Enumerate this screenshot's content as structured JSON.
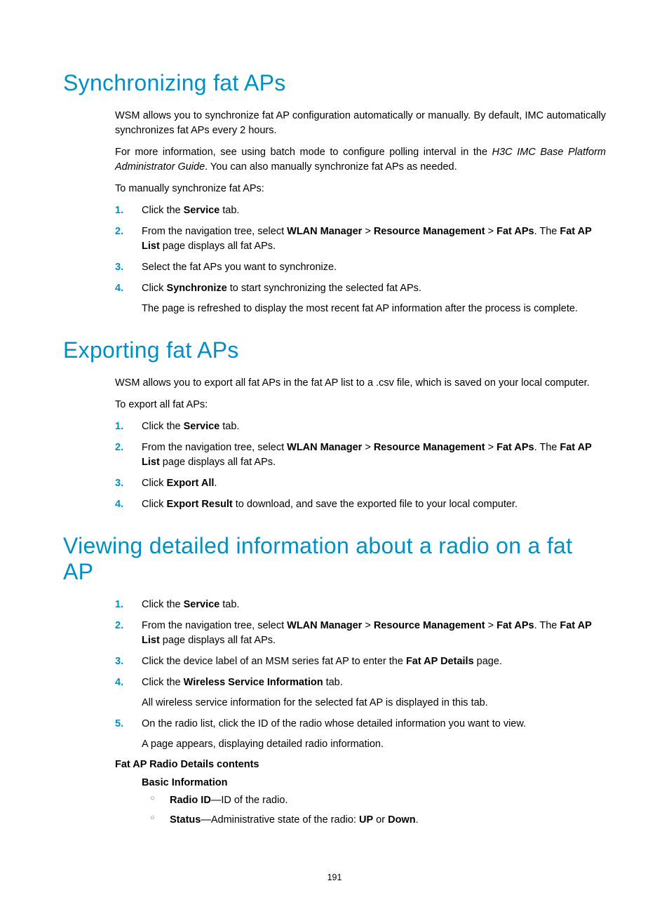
{
  "pageNumber": "191",
  "sections": [
    {
      "id": "sync",
      "heading": "Synchronizing fat APs",
      "intro1_pre": "WSM allows you to synchronize fat AP configuration automatically or manually. By default, IMC automatically synchronizes fat APs every 2 hours.",
      "intro2_pre": "For more information, see using batch mode to configure polling interval in the ",
      "intro2_italic": "H3C IMC Base Platform Administrator Guide",
      "intro2_post": ". You can also manually synchronize fat APs as needed.",
      "lead": "To manually synchronize fat APs:",
      "steps": [
        {
          "pre": "Click the ",
          "b1": "Service",
          "post": " tab."
        },
        {
          "pre": "From the navigation tree, select ",
          "b1": "WLAN Manager",
          "mid1": " > ",
          "b2": "Resource Management",
          "mid2": " > ",
          "b3": "Fat APs",
          "mid3": ". The ",
          "b4": "Fat AP List",
          "post": " page displays all fat APs."
        },
        {
          "pre": "Select the fat APs you want to synchronize."
        },
        {
          "pre": "Click ",
          "b1": "Synchronize",
          "post": " to start synchronizing the selected fat APs.",
          "sub": "The page is refreshed to display the most recent fat AP information after the process is complete."
        }
      ]
    },
    {
      "id": "export",
      "heading": "Exporting fat APs",
      "intro1_pre": "WSM allows you to export all fat APs in the fat AP list to a .csv file, which is saved on your local computer.",
      "lead": "To export all fat APs:",
      "steps": [
        {
          "pre": "Click the ",
          "b1": "Service",
          "post": " tab."
        },
        {
          "pre": "From the navigation tree, select ",
          "b1": "WLAN Manager",
          "mid1": " > ",
          "b2": "Resource Management",
          "mid2": " > ",
          "b3": "Fat APs",
          "mid3": ". The ",
          "b4": "Fat AP List",
          "post": " page displays all fat APs."
        },
        {
          "pre": "Click ",
          "b1": "Export All",
          "post": "."
        },
        {
          "pre": "Click ",
          "b1": "Export Result",
          "post": " to download, and save the exported file to your local computer."
        }
      ]
    },
    {
      "id": "view",
      "heading": "Viewing detailed information about a radio on a fat AP",
      "steps": [
        {
          "pre": "Click the ",
          "b1": "Service",
          "post": " tab."
        },
        {
          "pre": "From the navigation tree, select ",
          "b1": "WLAN Manager",
          "mid1": " > ",
          "b2": "Resource Management",
          "mid2": " > ",
          "b3": "Fat APs",
          "mid3": ". The ",
          "b4": "Fat AP List",
          "post": " page displays all fat APs."
        },
        {
          "pre": "Click the device label of an MSM series fat AP to enter the ",
          "b1": "Fat AP Details",
          "post": " page."
        },
        {
          "pre": "Click the ",
          "b1": "Wireless Service Information",
          "post": " tab.",
          "sub": "All wireless service information for the selected fat AP is displayed in this tab."
        },
        {
          "pre": "On the radio list, click the ID of the radio whose detailed information you want to view.",
          "sub": "A page appears, displaying detailed radio information."
        }
      ],
      "contentsTitle": "Fat AP Radio Details contents",
      "basicTitle": "Basic Information",
      "bullets": [
        {
          "b1": "Radio ID",
          "post": "—ID of the radio."
        },
        {
          "b1": "Status",
          "post": "—Administrative state of the radio: ",
          "b2": "UP",
          "mid": " or ",
          "b3": "Down",
          "post2": "."
        }
      ]
    }
  ]
}
